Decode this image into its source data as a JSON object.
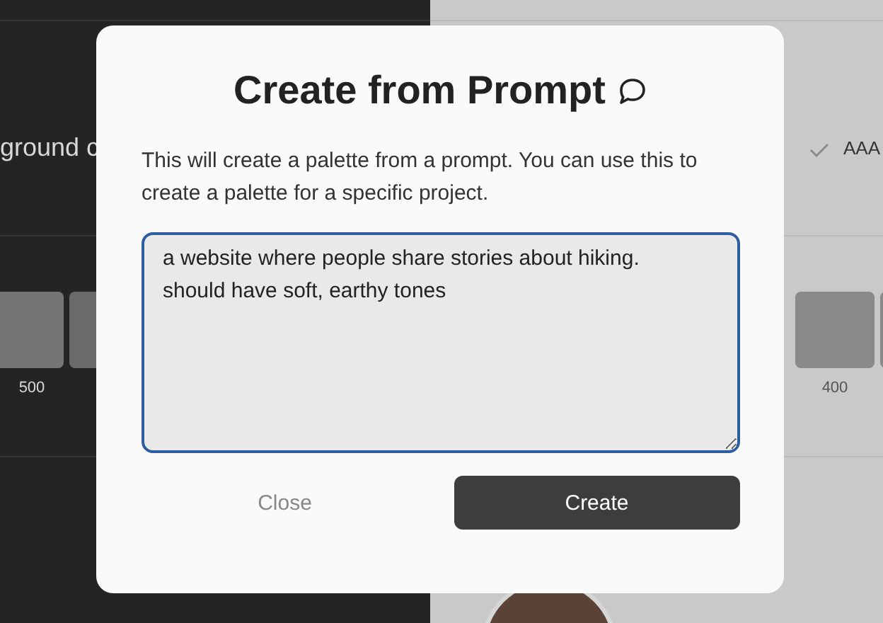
{
  "background": {
    "left_label": "ground c",
    "left_swatch_label": "500",
    "right_label": "AAA",
    "right_swatch_label": "400"
  },
  "dialog": {
    "title": "Create from Prompt",
    "description": "This will create a palette from a prompt. You can use this to create a palette for a specific project.",
    "prompt_value": "a website where people share stories about hiking.\nshould have soft, earthy tones",
    "buttons": [
      {
        "label": "Close",
        "kind": "secondary"
      },
      {
        "label": "Create",
        "kind": "primary"
      }
    ]
  }
}
